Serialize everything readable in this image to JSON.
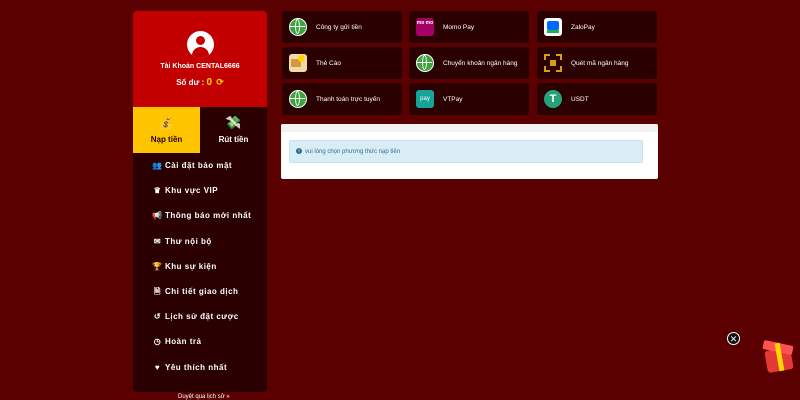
{
  "profile": {
    "account_label": "Tài Khoản",
    "account_name": "CENTAL6666",
    "balance_label": "Số dư :",
    "balance_value": "0",
    "refresh_icon": "⟳"
  },
  "actions": {
    "deposit_label": "Nạp tiền",
    "withdraw_label": "Rút tiền"
  },
  "menu": {
    "items": [
      {
        "label": "Cài đặt bảo mật",
        "icon": "users-gear-icon",
        "glyph": "👥"
      },
      {
        "label": "Khu vực VIP",
        "icon": "crown-icon",
        "glyph": "♛"
      },
      {
        "label": "Thông báo mới nhất",
        "icon": "megaphone-icon",
        "glyph": "📢"
      },
      {
        "label": "Thư nội bộ",
        "icon": "envelope-icon",
        "glyph": "✉"
      },
      {
        "label": "Khu sự kiện",
        "icon": "trophy-icon",
        "glyph": "🏆"
      },
      {
        "label": "Chi tiết giao dịch",
        "icon": "receipt-icon",
        "glyph": "🗎"
      },
      {
        "label": "Lịch sử đặt cược",
        "icon": "history-icon",
        "glyph": "↺"
      },
      {
        "label": "Hoàn trả",
        "icon": "clock-icon",
        "glyph": "◷"
      },
      {
        "label": "Yêu thích nhất",
        "icon": "heart-icon",
        "glyph": "♥"
      }
    ]
  },
  "footer_text": "Duyệt qua lịch sử »",
  "payments": [
    {
      "label": "Công ty gửi tiền",
      "icon": "globe-icon"
    },
    {
      "label": "Momo Pay",
      "icon": "momo-icon",
      "logo_text": "mo mo"
    },
    {
      "label": "ZaloPay",
      "icon": "zalopay-icon"
    },
    {
      "label": "Thẻ Cào",
      "icon": "scratch-card-icon"
    },
    {
      "label": "Chuyển khoản ngân hàng",
      "icon": "globe-icon"
    },
    {
      "label": "Quét mã ngân hàng",
      "icon": "qr-scan-icon"
    },
    {
      "label": "Thanh toán trực tuyến",
      "icon": "globe-icon"
    },
    {
      "label": "VTPay",
      "icon": "vtpay-icon",
      "logo_text": "pay"
    },
    {
      "label": "USDT",
      "icon": "usdt-icon",
      "logo_text": "T"
    }
  ],
  "notice": {
    "message": "vui lòng chọn phương thức nạp tiền"
  },
  "colors": {
    "background": "#5a0000",
    "panel": "#2a0000",
    "profile_red": "#c30000",
    "accent_yellow": "#ffc400"
  }
}
